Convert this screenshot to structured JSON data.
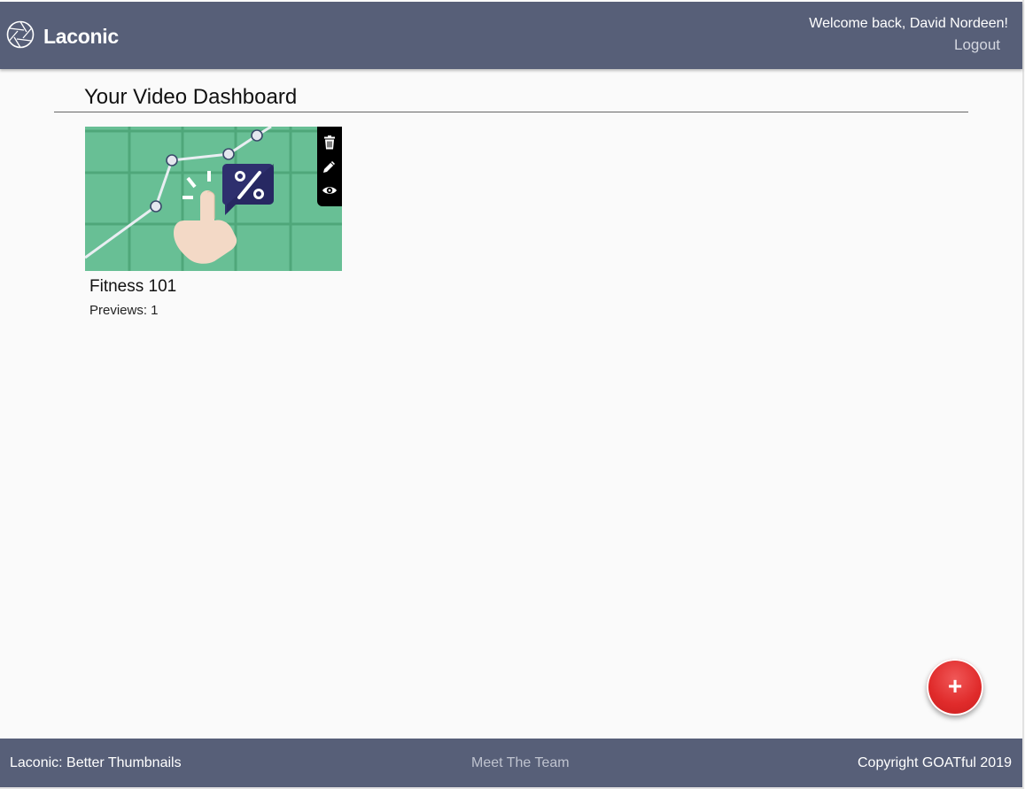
{
  "header": {
    "brand_name": "Laconic",
    "welcome_text": "Welcome back, David Nordeen!",
    "logout_label": "Logout",
    "logo_icon": "aperture-icon",
    "background_color": "#575f78"
  },
  "main": {
    "page_title": "Your Video Dashboard",
    "videos": [
      {
        "title": "Fitness 101",
        "previews_text": "Previews: 1",
        "actions": [
          "trash-icon",
          "pencil-icon",
          "eye-icon"
        ]
      }
    ]
  },
  "fab": {
    "label": "+",
    "color": "#e02b2b"
  },
  "footer": {
    "left_text": "Laconic: Better Thumbnails",
    "center_link": "Meet The Team",
    "right_text": "Copyright GOATful 2019"
  }
}
